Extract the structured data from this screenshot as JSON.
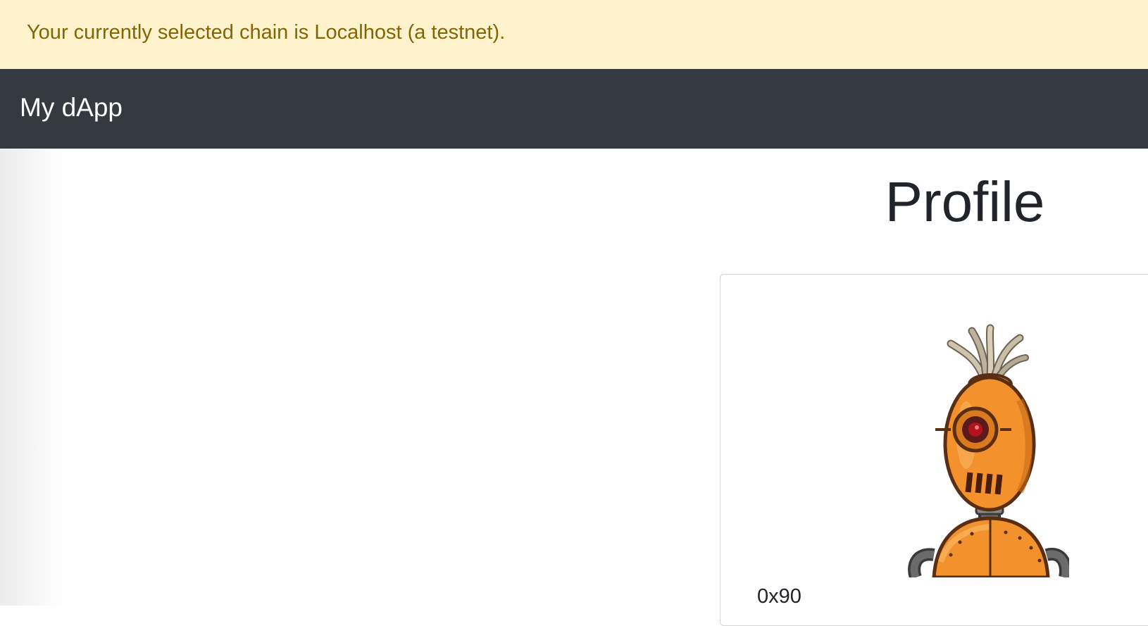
{
  "alert": {
    "message": "Your currently selected chain is Localhost (a testnet)."
  },
  "navbar": {
    "brand": "My dApp"
  },
  "profile": {
    "title": "Profile",
    "avatar_icon": "robot-avatar-icon",
    "address_partial": "0x90"
  },
  "colors": {
    "alert_bg": "#fff3cd",
    "alert_text": "#856404",
    "navbar_bg": "#343a40",
    "avatar_orange": "#f3922c"
  }
}
